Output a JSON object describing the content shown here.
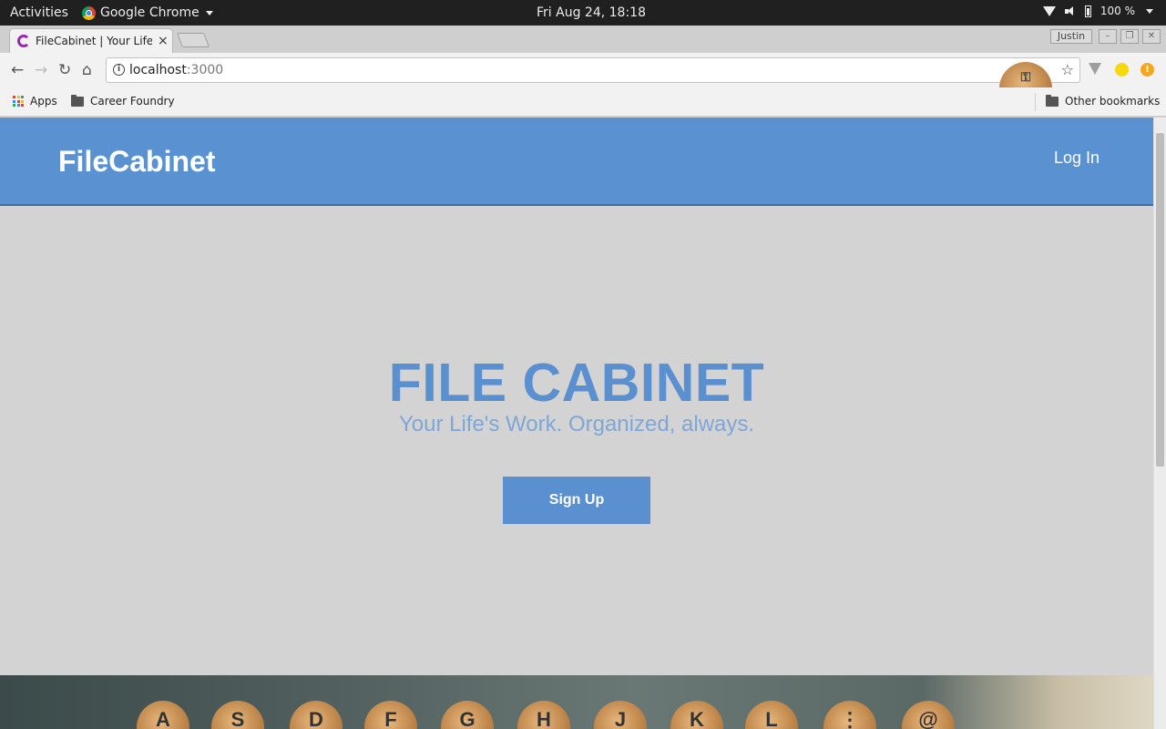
{
  "system": {
    "activities": "Activities",
    "app_menu": "Google Chrome",
    "clock": "Fri Aug 24, 18:18",
    "battery": "100 %"
  },
  "browser": {
    "tab_title": "FileCabinet | Your Life'",
    "tab_close": "×",
    "profile": "Justin",
    "url_host": "localhost",
    "url_port": ":3000",
    "bookmarks": {
      "apps": "Apps",
      "career": "Career Foundry",
      "other": "Other bookmarks"
    }
  },
  "site": {
    "brand": "FileCabinet",
    "login": "Log In",
    "hero_title": "FILE CABINET",
    "hero_subtitle": "Your Life's Work. Organized, always.",
    "signup": "Sign Up",
    "keys": [
      "A",
      "S",
      "D",
      "F",
      "G",
      "H",
      "J",
      "K",
      "L",
      "⋮",
      "@"
    ]
  },
  "colors": {
    "navbar": "#5a91d0",
    "accent": "#5a8fd0",
    "page_bg": "#d3d3d3"
  }
}
